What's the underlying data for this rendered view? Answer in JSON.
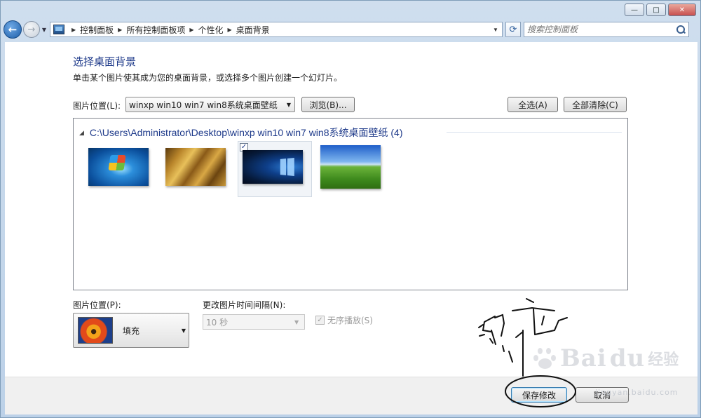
{
  "window": {
    "caption": {
      "minimize": "—",
      "maximize": "□",
      "close": "✕"
    }
  },
  "nav": {
    "breadcrumbs": [
      "控制面板",
      "所有控制面板项",
      "个性化",
      "桌面背景"
    ],
    "search_placeholder": "搜索控制面板"
  },
  "page": {
    "title": "选择桌面背景",
    "description": "单击某个图片使其成为您的桌面背景，或选择多个图片创建一个幻灯片。",
    "location_label": "图片位置(L):",
    "location_value": "winxp win10 win7 win8系统桌面壁纸",
    "browse_label": "浏览(B)...",
    "select_all_label": "全选(A)",
    "clear_all_label": "全部清除(C)"
  },
  "gallery": {
    "group_header": "C:\\Users\\Administrator\\Desktop\\winxp win10 win7 win8系统桌面壁纸 (4)",
    "items": [
      {
        "name": "win7",
        "selected": false
      },
      {
        "name": "grass",
        "selected": false
      },
      {
        "name": "win10",
        "selected": true
      },
      {
        "name": "winxp-bliss",
        "selected": false
      }
    ]
  },
  "options": {
    "position_label": "图片位置(P):",
    "position_value": "填充",
    "interval_label": "更改图片时间间隔(N):",
    "interval_value": "10 秒",
    "shuffle_label": "无序播放(S)",
    "shuffle_checked": true
  },
  "footer": {
    "save_label": "保存修改",
    "cancel_label": "取消"
  },
  "watermark": {
    "brand": "Bai",
    "brand2": "du",
    "sub": "经验",
    "url": "jingyan.baidu.com"
  },
  "colors": {
    "title_blue": "#1e3a8a",
    "frame": "#bcd1e8"
  }
}
